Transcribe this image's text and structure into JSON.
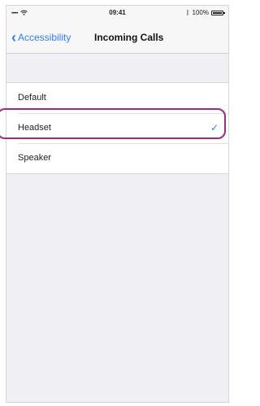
{
  "status_bar": {
    "signal": "•••••",
    "time": "09:41",
    "battery": "100%"
  },
  "nav": {
    "back_label": "Accessibility",
    "title": "Incoming Calls"
  },
  "options": [
    {
      "label": "Default",
      "selected": false
    },
    {
      "label": "Headset",
      "selected": true
    },
    {
      "label": "Speaker",
      "selected": false
    }
  ],
  "icons": {
    "back": "chevron-left-icon",
    "selected": "checkmark-icon"
  },
  "colors": {
    "accent": "#2f7ef6",
    "highlight": "#a4287e",
    "background": "#efeff4"
  }
}
